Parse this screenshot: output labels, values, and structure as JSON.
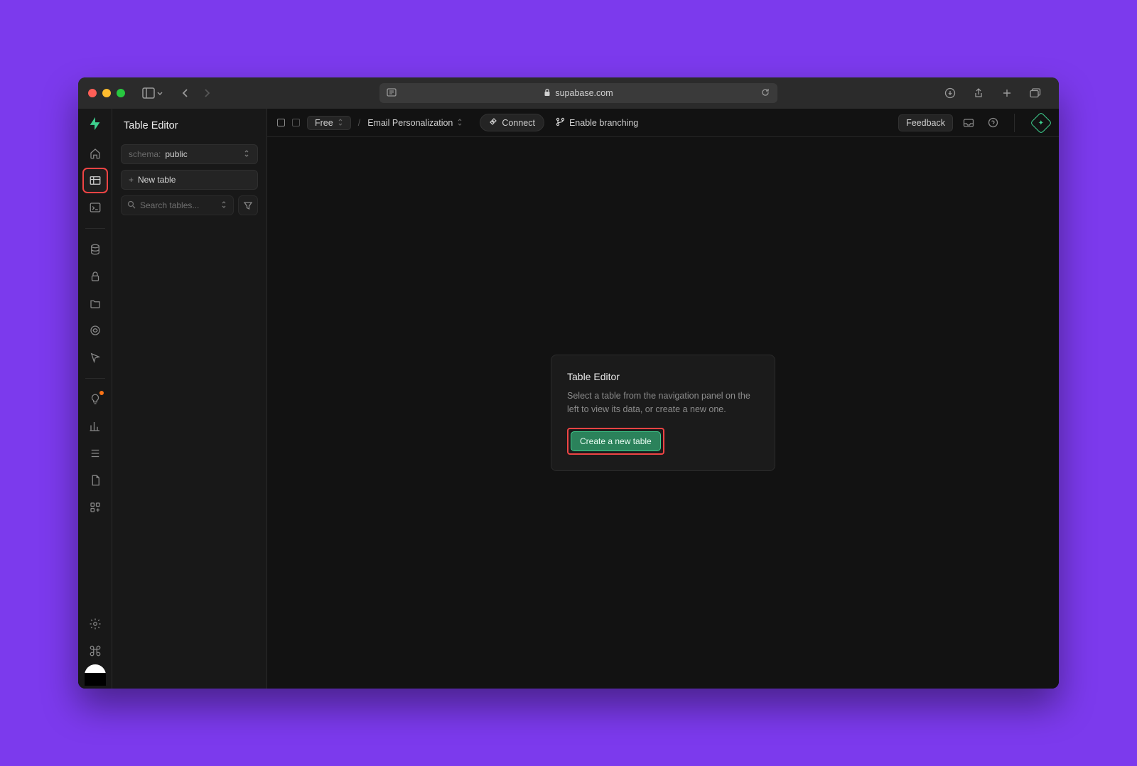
{
  "browser": {
    "url_host": "supabase.com"
  },
  "topbar": {
    "free_label": "Free",
    "project_name": "Email Personalization",
    "connect_label": "Connect",
    "enable_branching": "Enable branching",
    "feedback_label": "Feedback"
  },
  "sidepanel": {
    "title": "Table Editor",
    "schema_prefix": "schema:",
    "schema_value": "public",
    "new_table_label": "New table",
    "search_placeholder": "Search tables..."
  },
  "empty_state": {
    "title": "Table Editor",
    "description": "Select a table from the navigation panel on the left to view its data, or create a new one.",
    "create_button": "Create a new table"
  },
  "colors": {
    "accent_green": "#3ecf8e",
    "highlight_red": "#ef4444",
    "purple_bg": "#7c3aed"
  }
}
